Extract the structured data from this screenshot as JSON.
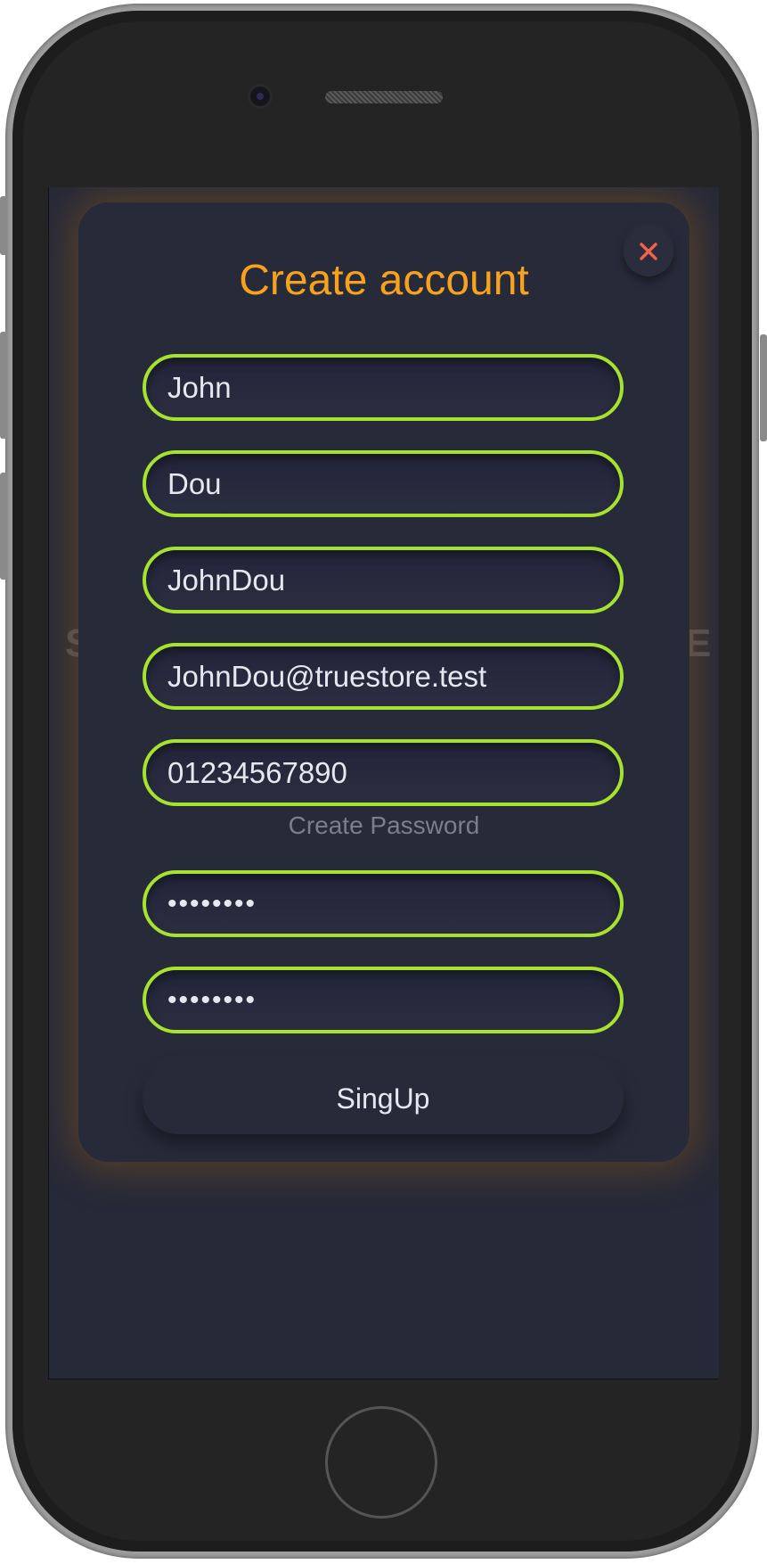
{
  "modal": {
    "title": "Create account",
    "close_icon": "close-icon",
    "close_color": "#f0604a",
    "accent_color": "#a6e22e",
    "title_color": "#f7a21c"
  },
  "form": {
    "first_name": "John",
    "last_name": "Dou",
    "username": "JohnDou",
    "email": "JohnDou@truestore.test",
    "phone": "01234567890",
    "password_caption": "Create Password",
    "password": "••••••••",
    "password_confirm": "••••••••",
    "submit_label": "SingUp"
  },
  "background": {
    "left_letter": "S",
    "right_letter": "E"
  }
}
